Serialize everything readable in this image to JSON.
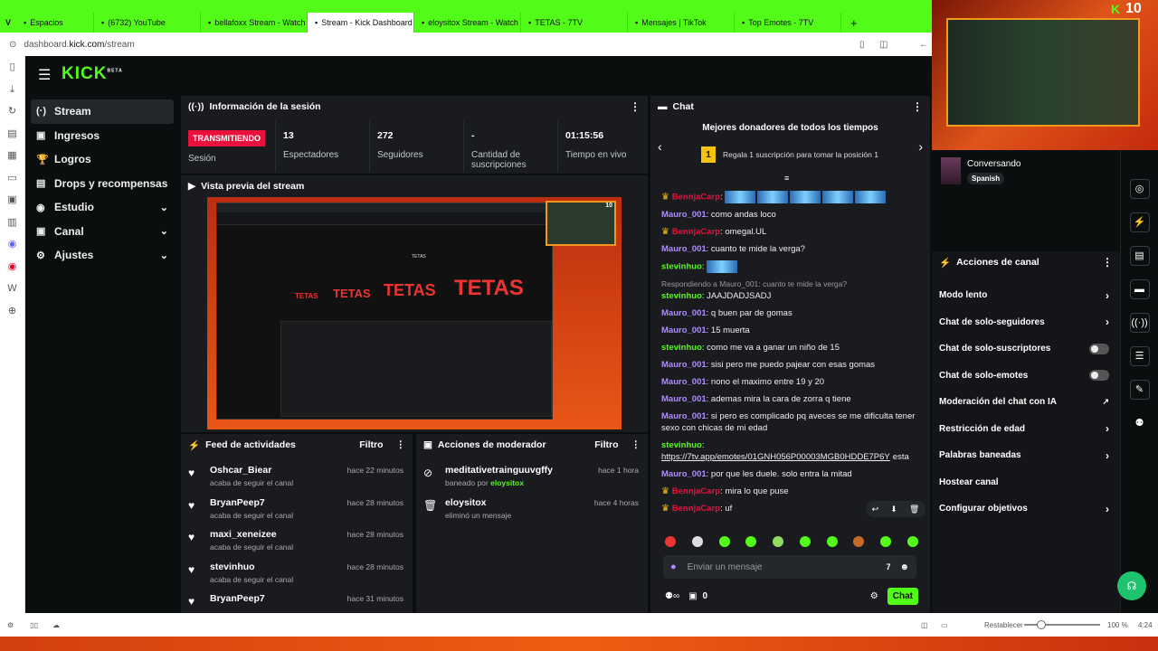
{
  "browser": {
    "tabs": [
      {
        "label": "Espacios",
        "active": false
      },
      {
        "label": "(6732) YouTube",
        "active": false
      },
      {
        "label": "bellafoxx Stream - Watch L",
        "active": false
      },
      {
        "label": "Stream - Kick Dashboard",
        "active": true
      },
      {
        "label": "eloysitox Stream - Watch L",
        "active": false
      },
      {
        "label": "TETAS - 7TV",
        "active": false
      },
      {
        "label": "Mensajes | TikTok",
        "active": false
      },
      {
        "label": "Top Emotes - 7TV",
        "active": false
      }
    ],
    "new_tab": "+",
    "url_prefix": "dashboard.",
    "url_host": "kick.com",
    "url_path": "/stream"
  },
  "header": {
    "logo": "KICK",
    "logo_sup": "BETA"
  },
  "sidebar": {
    "items": [
      {
        "label": "Stream",
        "icon": "(·)",
        "active": true,
        "chev": ""
      },
      {
        "label": "Ingresos",
        "icon": "▣",
        "active": false,
        "chev": ""
      },
      {
        "label": "Logros",
        "icon": "🏆",
        "active": false,
        "chev": ""
      },
      {
        "label": "Drops y recompensas",
        "icon": "▤",
        "active": false,
        "chev": ""
      },
      {
        "label": "Estudio",
        "icon": "◉",
        "active": false,
        "chev": "⌄"
      },
      {
        "label": "Canal",
        "icon": "▣",
        "active": false,
        "chev": "⌄"
      },
      {
        "label": "Ajustes",
        "icon": "⚙",
        "active": false,
        "chev": "⌄"
      }
    ]
  },
  "session": {
    "title": "Información de la sesión",
    "live_badge": "TRANSMITIENDO",
    "session_label": "Sesión",
    "stats": [
      {
        "value": "13",
        "label": "Espectadores"
      },
      {
        "value": "272",
        "label": "Seguidores"
      },
      {
        "value": "-",
        "label": "Cantidad de suscripciones"
      },
      {
        "value": "01:15:56",
        "label": "Tiempo en vivo"
      }
    ]
  },
  "preview": {
    "title": "Vista previa del stream",
    "inner_title": "TETAS",
    "words": [
      "TETAS",
      "TETAS",
      "TETAS",
      "TETAS"
    ],
    "cam_badge": "10"
  },
  "feed": {
    "title": "Feed de actividades",
    "filter": "Filtro",
    "items": [
      {
        "user": "Oshcar_Biear",
        "action": "acaba de seguir el canal",
        "time": "hace 22 minutos"
      },
      {
        "user": "BryanPeep7",
        "action": "acaba de seguir el canal",
        "time": "hace 28 minutos"
      },
      {
        "user": "maxi_xeneizee",
        "action": "acaba de seguir el canal",
        "time": "hace 28 minutos"
      },
      {
        "user": "stevinhuo",
        "action": "acaba de seguir el canal",
        "time": "hace 28 minutos"
      },
      {
        "user": "BryanPeep7",
        "action": "",
        "time": "hace 31 minutos"
      }
    ]
  },
  "mod": {
    "title": "Acciones de moderador",
    "filter": "Filtro",
    "items": [
      {
        "user": "meditativetrainguuvgffy",
        "action_prefix": "baneado por ",
        "by": "eloysitox",
        "time": "hace 1 hora",
        "icon": "⊘"
      },
      {
        "user": "eloysitox",
        "action_prefix": "eliminó un mensaje",
        "by": "",
        "time": "hace 4 horas",
        "icon": "🗑"
      }
    ]
  },
  "chat": {
    "title": "Chat",
    "donors_title": "Mejores donadores de todos los tiempos",
    "donor_rank": "1",
    "donor_text": "Regala 1 suscripción para tomar la posición 1",
    "reply_to": "Respondiendo a Mauro_001: cuanto te mide la verga?",
    "link": "https://7tv.app/emotes/01GNH056P00003MGB0HDDE7P6Y",
    "link_after": "esta",
    "messages": [
      {
        "user": "BennjaCarp",
        "color": "#e9113c",
        "crown": true,
        "text": "",
        "emotes": 5
      },
      {
        "user": "Mauro_001",
        "color": "#b18cff",
        "crown": false,
        "text": "como andas loco"
      },
      {
        "user": "BennjaCarp",
        "color": "#e9113c",
        "crown": true,
        "text": "omegal.UL"
      },
      {
        "user": "Mauro_001",
        "color": "#b18cff",
        "crown": false,
        "text": "cuanto te mide la verga?"
      },
      {
        "user": "stevinhuo",
        "color": "#53fc18",
        "crown": false,
        "text": "",
        "emotes": 1
      },
      {
        "user": "stevinhuo",
        "color": "#53fc18",
        "crown": false,
        "text": "JAAJDADJSADJ",
        "reply": true
      },
      {
        "user": "Mauro_001",
        "color": "#b18cff",
        "crown": false,
        "text": "q buen par de gomas"
      },
      {
        "user": "Mauro_001",
        "color": "#b18cff",
        "crown": false,
        "text": "15 muerta"
      },
      {
        "user": "stevinhuo",
        "color": "#53fc18",
        "crown": false,
        "text": "como me va a ganar un niño de 15"
      },
      {
        "user": "Mauro_001",
        "color": "#b18cff",
        "crown": false,
        "text": "sisi pero me puedo pajear con esas gomas"
      },
      {
        "user": "Mauro_001",
        "color": "#b18cff",
        "crown": false,
        "text": "nono el maximo entre 19 y 20"
      },
      {
        "user": "Mauro_001",
        "color": "#b18cff",
        "crown": false,
        "text": "ademas mira la cara de zorra q tiene"
      },
      {
        "user": "Mauro_001",
        "color": "#b18cff",
        "crown": false,
        "text": "si pero es complicado pq aveces se me dificulta tener sexo con chicas de mi edad"
      },
      {
        "user": "stevinhuo",
        "color": "#53fc18",
        "crown": false,
        "text": "",
        "link": true
      },
      {
        "user": "Mauro_001",
        "color": "#b18cff",
        "crown": false,
        "text": "por que les duele. solo entra la mitad"
      },
      {
        "user": "BennjaCarp",
        "color": "#e9113c",
        "crown": true,
        "text": "mira lo que puse"
      },
      {
        "user": "BennjaCarp",
        "color": "#e9113c",
        "crown": true,
        "text": "uf"
      }
    ],
    "input_placeholder": "Enviar un mensaje",
    "count": "0",
    "send": "Chat"
  },
  "webcam": {
    "badge": "10"
  },
  "category": {
    "name": "Conversando",
    "lang": "Spanish"
  },
  "channel_actions": {
    "title": "Acciones de canal",
    "items": [
      {
        "label": "Modo lento",
        "ctl": "chev"
      },
      {
        "label": "Chat de solo-seguidores",
        "ctl": "chev"
      },
      {
        "label": "Chat de solo-suscriptores",
        "ctl": "toggle"
      },
      {
        "label": "Chat de solo-emotes",
        "ctl": "toggle"
      },
      {
        "label": "Moderación del chat con IA",
        "ctl": "ext"
      },
      {
        "label": "Restricción de edad",
        "ctl": "chev"
      },
      {
        "label": "Palabras baneadas",
        "ctl": "chev"
      },
      {
        "label": "Hostear canal",
        "ctl": "none"
      },
      {
        "label": "Configurar objetivos",
        "ctl": "chev"
      }
    ]
  },
  "statusbar": {
    "reset": "Restablecer",
    "zoom": "100 %",
    "time": "4:24"
  },
  "colors": {
    "accent": "#53fc18",
    "live": "#e9113c",
    "panel": "#191b1f",
    "bg": "#0b0e0f"
  }
}
